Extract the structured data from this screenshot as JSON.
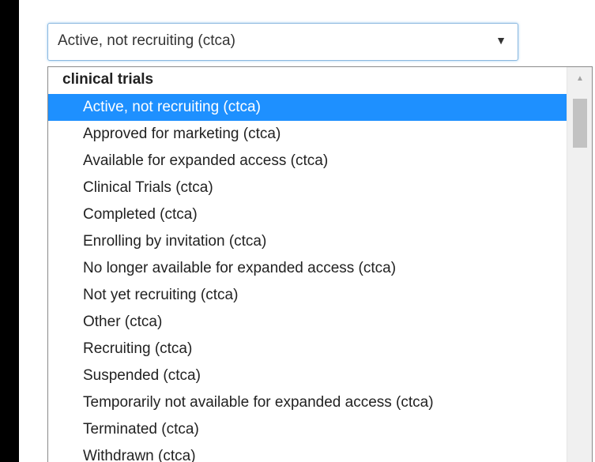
{
  "select": {
    "value": "Active, not recruiting (ctca)",
    "arrow_icon": "triangle-down"
  },
  "dropdown": {
    "group_label": "clinical trials",
    "selected_index": 0,
    "options": [
      "Active, not recruiting (ctca)",
      "Approved for marketing (ctca)",
      "Available for expanded access (ctca)",
      "Clinical Trials (ctca)",
      "Completed (ctca)",
      "Enrolling by invitation (ctca)",
      "No longer available for expanded access (ctca)",
      "Not yet recruiting (ctca)",
      "Other (ctca)",
      "Recruiting (ctca)",
      "Suspended (ctca)",
      "Temporarily not available for expanded access (ctca)",
      "Terminated (ctca)",
      "Withdrawn (ctca)"
    ]
  },
  "scrollbar": {
    "up_icon": "triangle-up"
  },
  "colors": {
    "selection": "#1e90ff",
    "select_border": "#8bb8df",
    "background": "#000000"
  }
}
